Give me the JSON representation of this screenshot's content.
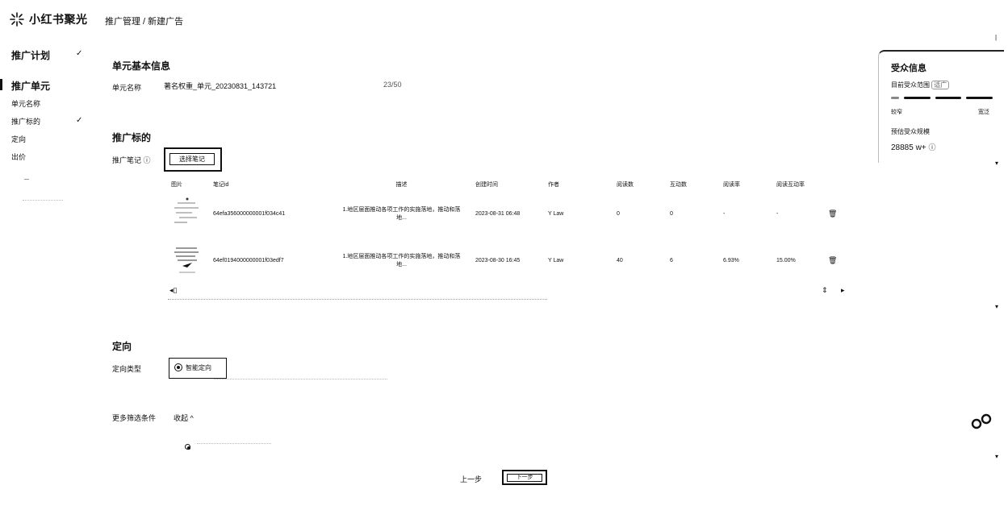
{
  "app": {
    "brand": "小红书聚光",
    "breadcrumb": "推广管理 / 新建广告"
  },
  "sidebar": {
    "plan_label": "推广计划",
    "unit_label": "推广单元",
    "sub_items": [
      {
        "label": "单元名称",
        "checked": false
      },
      {
        "label": "推广标的",
        "checked": true
      },
      {
        "label": "定向",
        "checked": false
      },
      {
        "label": "出价",
        "checked": false
      }
    ],
    "check_glyph": "✓"
  },
  "basic": {
    "title": "单元基本信息",
    "name_label": "单元名称",
    "name_value": "著名权重_单元_20230831_143721",
    "name_count": "23/50"
  },
  "target": {
    "title": "推广标的",
    "note_label": "推广笔记",
    "info_glyph": "ⓘ",
    "select_button": "选择笔记",
    "columns": [
      "图片",
      "笔记id",
      "描述",
      "创建时间",
      "作者",
      "阅读数",
      "互动数",
      "阅读率",
      "阅读互动率"
    ],
    "rows": [
      {
        "id": "64efa356000000001f034c41",
        "desc": "1.地区层面推动各项工作的实施落地，推动和落地...",
        "time": "2023-08-31 06:48",
        "author": "Y Law",
        "reads": "0",
        "interactions": "0",
        "read_rate": "-",
        "engage_rate": "-"
      },
      {
        "id": "64ef0194000000001f03edf7",
        "desc": "1.地区层面推动各项工作的实施落地，推动和落地...",
        "time": "2023-08-30 16:45",
        "author": "Y Law",
        "reads": "40",
        "interactions": "6",
        "read_rate": "6.93%",
        "engage_rate": "15.00%"
      }
    ],
    "delete_glyph": "🗑"
  },
  "targeting": {
    "title": "定向",
    "type_label": "定向类型",
    "type_value": "智能定向",
    "more_label": "更多筛选条件",
    "collapse_label": "收起 ^"
  },
  "audience": {
    "title": "受众信息",
    "range_label": "目前受众范围",
    "range_tag": "适广",
    "low_label": "较窄",
    "high_label": "宽泛",
    "est_label": "预估受众规模",
    "est_value": "28885 w+",
    "est_icon": "ⓘ"
  },
  "footer": {
    "prev_label": "上一步",
    "next_label": "下一步"
  },
  "colors": {
    "text": "#111111",
    "muted": "#888888",
    "border": "#222222"
  }
}
